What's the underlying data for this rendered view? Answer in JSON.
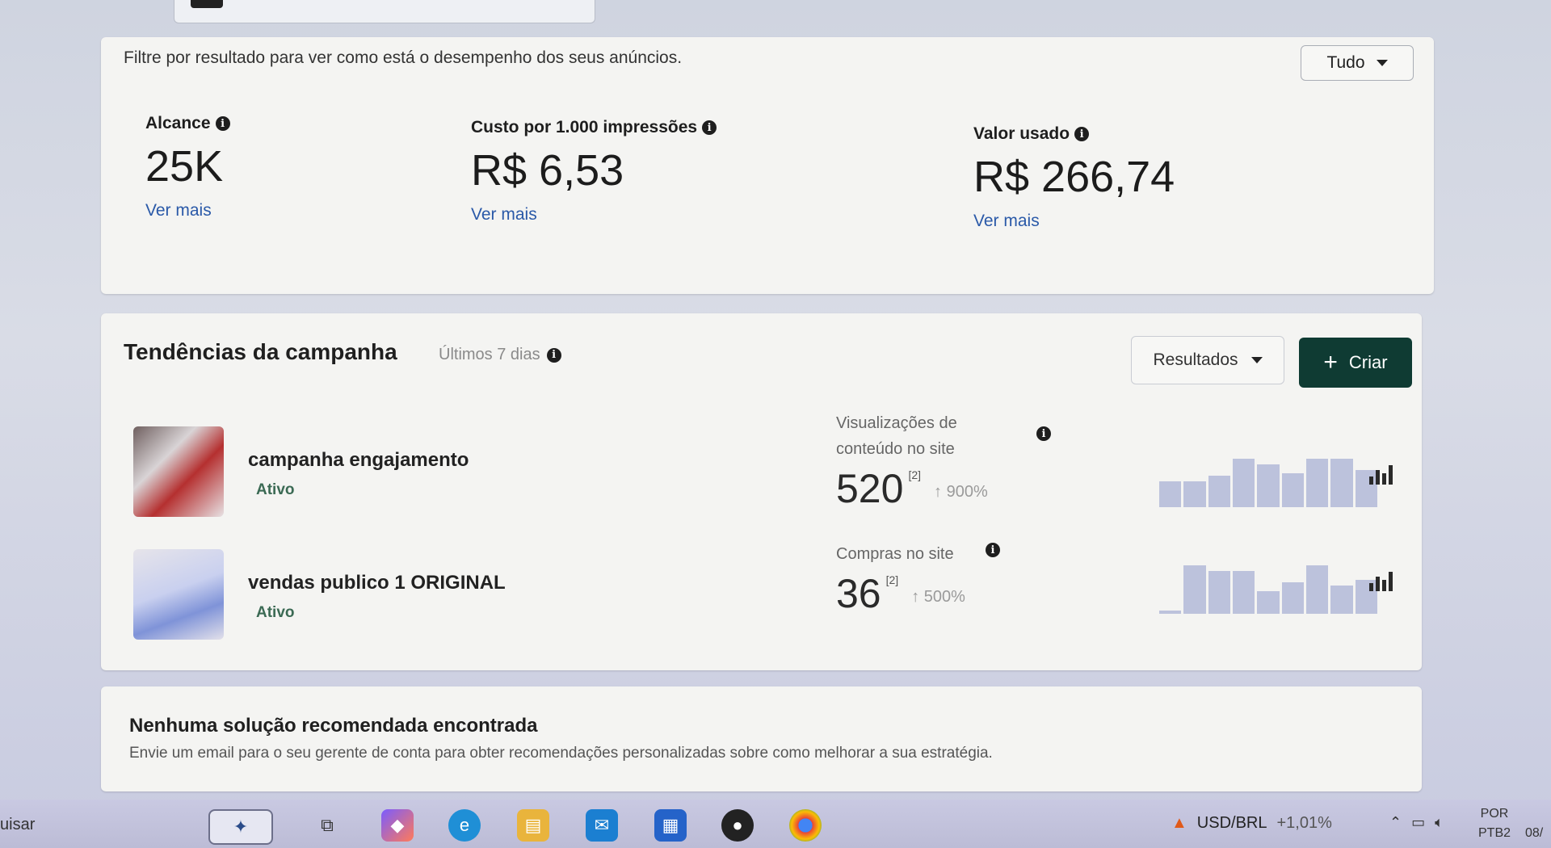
{
  "summary": {
    "filter_text": "Filtre por resultado para ver como está o desempenho dos seus anúncios.",
    "filter_value": "Tudo",
    "metrics": [
      {
        "label": "Alcance",
        "value": "25K",
        "more": "Ver mais"
      },
      {
        "label": "Custo por 1.000 impressões",
        "value": "R$ 6,53",
        "more": "Ver mais"
      },
      {
        "label": "Valor usado",
        "value": "R$ 266,74",
        "more": "Ver mais"
      }
    ]
  },
  "trends": {
    "title": "Tendências da campanha",
    "period": "Últimos 7 dias",
    "results_select": "Resultados",
    "create_label": "Criar",
    "campaigns": [
      {
        "name": "campanha engajamento",
        "status": "Ativo",
        "kpi_label": "Visualizações de conteúdo no site",
        "kpi_value": "520",
        "kpi_footnote": "[2]",
        "kpi_delta": "900%",
        "trend": [
          0.45,
          0.45,
          0.55,
          0.85,
          0.75,
          0.6,
          0.85,
          0.85,
          0.65
        ]
      },
      {
        "name": "vendas publico 1 ORIGINAL",
        "status": "Ativo",
        "kpi_label": "Compras no site",
        "kpi_value": "36",
        "kpi_footnote": "[2]",
        "kpi_delta": "500%",
        "trend": [
          0.05,
          0.85,
          0.75,
          0.75,
          0.4,
          0.55,
          0.85,
          0.5,
          0.6
        ]
      }
    ]
  },
  "recommendations": {
    "title": "Nenhuma solução recomendada encontrada",
    "text": "Envie um email para o seu gerente de conta para obter recomendações personalizadas sobre como melhorar a sua estratégia."
  },
  "taskbar": {
    "search_fragment": "uisar",
    "ticker_pair": "USD/BRL",
    "ticker_change": "+1,01%",
    "lang_top": "POR",
    "lang_bottom": "PTB2",
    "clock_fragment": "08/"
  },
  "colors": {
    "accent_dark_green": "#0f3b33",
    "link_blue": "#2a59a8",
    "status_green": "#3b6a54"
  }
}
